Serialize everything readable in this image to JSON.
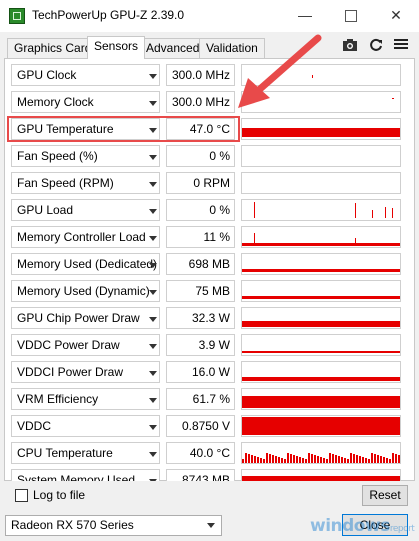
{
  "window": {
    "title": "TechPowerUp GPU-Z 2.39.0"
  },
  "tabs": [
    {
      "label": "Graphics Card"
    },
    {
      "label": "Sensors"
    },
    {
      "label": "Advanced"
    },
    {
      "label": "Validation"
    }
  ],
  "sensors": [
    {
      "name": "GPU Clock",
      "value": "300.0 MHz"
    },
    {
      "name": "Memory Clock",
      "value": "300.0 MHz"
    },
    {
      "name": "GPU Temperature",
      "value": "47.0 °C"
    },
    {
      "name": "Fan Speed (%)",
      "value": "0 %"
    },
    {
      "name": "Fan Speed (RPM)",
      "value": "0 RPM"
    },
    {
      "name": "GPU Load",
      "value": "0 %"
    },
    {
      "name": "Memory Controller Load",
      "value": "11 %"
    },
    {
      "name": "Memory Used (Dedicated)",
      "value": "698 MB"
    },
    {
      "name": "Memory Used (Dynamic)",
      "value": "75 MB"
    },
    {
      "name": "GPU Chip Power Draw",
      "value": "32.3 W"
    },
    {
      "name": "VDDC Power Draw",
      "value": "3.9 W"
    },
    {
      "name": "VDDCI Power Draw",
      "value": "16.0 W"
    },
    {
      "name": "VRM Efficiency",
      "value": "61.7 %"
    },
    {
      "name": "VDDC",
      "value": "0.8750 V"
    },
    {
      "name": "CPU Temperature",
      "value": "40.0 °C"
    },
    {
      "name": "System Memory Used",
      "value": "8743 MB"
    }
  ],
  "log_to_file_label": "Log to file",
  "reset_label": "Reset",
  "gpu_select": {
    "value": "Radeon RX 570 Series"
  },
  "close_label": "Close",
  "watermark": {
    "text": "windows",
    "sub": "report"
  },
  "colors": {
    "graph": "#e60000",
    "highlight": "#e84a4a",
    "arrow": "#e84a4a"
  }
}
